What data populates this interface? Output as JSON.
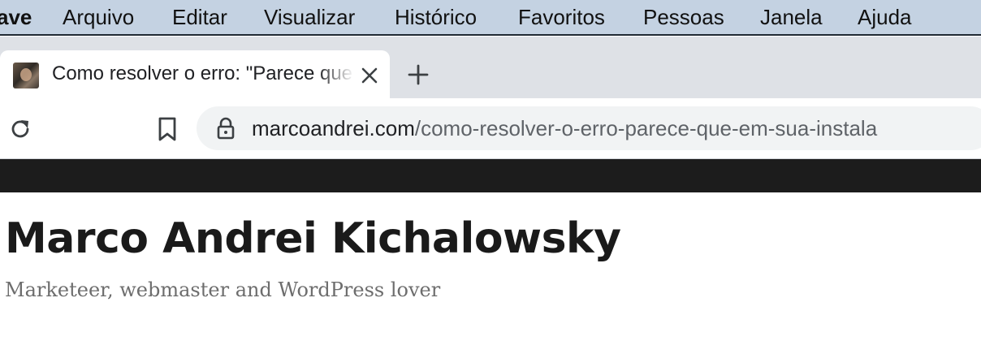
{
  "menubar": {
    "app_name": "ave",
    "items": [
      "Arquivo",
      "Editar",
      "Visualizar",
      "Histórico",
      "Favoritos",
      "Pessoas",
      "Janela",
      "Ajuda"
    ]
  },
  "tab": {
    "title": "Como resolver o erro: \"Parece que em sua instalação\"",
    "favicon": "author-photo"
  },
  "address_bar": {
    "host": "marcoandrei.com",
    "path": "/como-resolver-o-erro-parece-que-em-sua-instala"
  },
  "site": {
    "title": "Marco Andrei Kichalowsky",
    "tagline": "Marketeer, webmaster and WordPress lover"
  },
  "colors": {
    "menubar_bg": "#c4d2e2",
    "tabstrip_bg": "#dee1e6",
    "site_header_bg": "#1c1c1c",
    "title_text": "#1a1a1a",
    "tagline_text": "#6d6d6d"
  }
}
